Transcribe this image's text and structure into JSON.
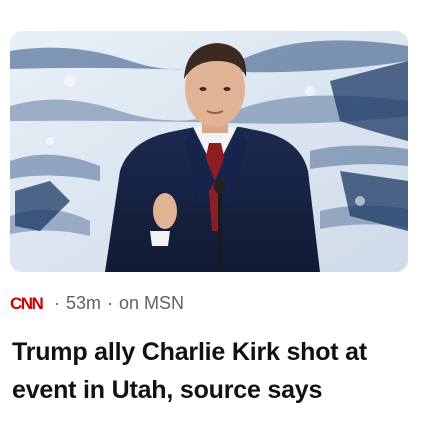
{
  "card": {
    "source_logo_text": "CNN",
    "brand_color": "#cc0000",
    "separator": "·",
    "time_ago": "53m",
    "provider": "on MSN",
    "headline": "Trump ally Charlie Kirk shot at event in Utah, source says"
  },
  "image": {
    "icon": "news-photo"
  }
}
